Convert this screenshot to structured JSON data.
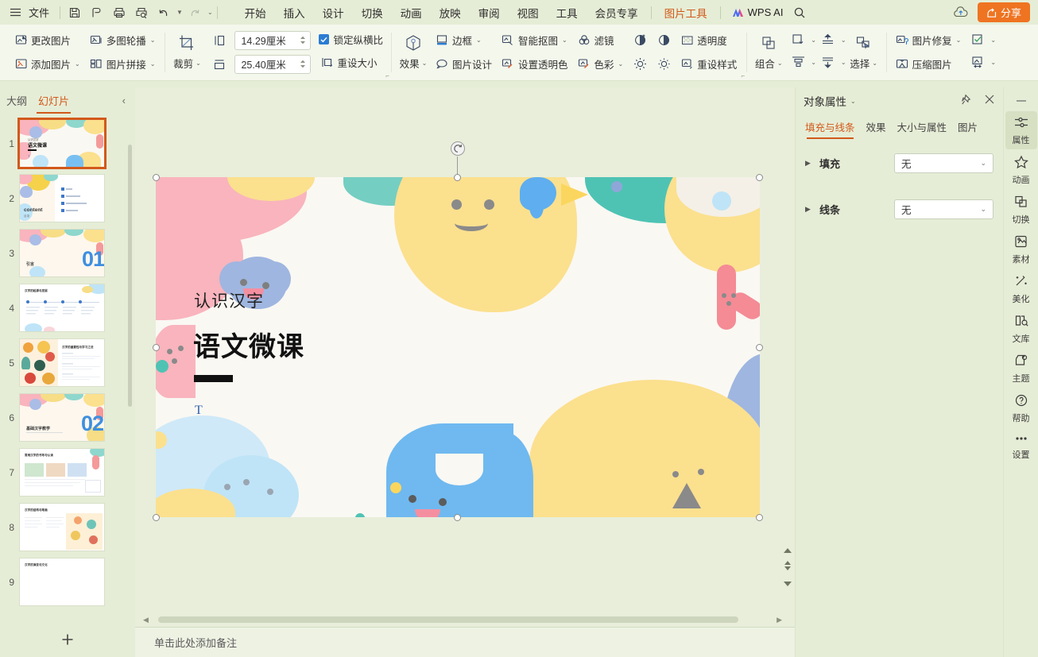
{
  "app": {
    "file_menu": "文件",
    "quick_icons": [
      "save-icon",
      "cloud-save-icon",
      "print-icon",
      "print-preview-icon",
      "undo-icon",
      "redo-icon",
      "customize-icon"
    ],
    "menus": [
      {
        "label": "开始",
        "active": false
      },
      {
        "label": "插入",
        "active": false
      },
      {
        "label": "设计",
        "active": false
      },
      {
        "label": "切换",
        "active": false
      },
      {
        "label": "动画",
        "active": false
      },
      {
        "label": "放映",
        "active": false
      },
      {
        "label": "审阅",
        "active": false
      },
      {
        "label": "视图",
        "active": false
      },
      {
        "label": "工具",
        "active": false
      },
      {
        "label": "会员专享",
        "active": false
      },
      {
        "label": "图片工具",
        "active": true
      }
    ],
    "wps_ai": "WPS AI",
    "search_icon": "search-icon",
    "upload_icon": "cloud-upload-icon",
    "share_label": "分享"
  },
  "ribbon": {
    "group_picture": {
      "change_picture": "更改图片",
      "add_picture": "添加图片",
      "multi_carousel": "多图轮播",
      "picture_stitch": "图片拼接"
    },
    "group_size": {
      "crop": "裁剪",
      "height_value": "14.29厘米",
      "width_value": "25.40厘米",
      "lock_ratio": "锁定纵横比",
      "lock_ratio_checked": true,
      "reset_size": "重设大小"
    },
    "group_style": {
      "effects": "效果",
      "border": "边框",
      "picture_design": "图片设计",
      "smart_cutout": "智能抠图",
      "set_transparent_color": "设置透明色",
      "filter": "滤镜",
      "color": "色彩",
      "transparency": "透明度",
      "reset_style": "重设样式"
    },
    "group_arrange": {
      "group": "组合",
      "rotate": "旋转",
      "align": "对齐",
      "bring_forward": "上移一层",
      "send_backward": "下移一层",
      "select": "选择"
    },
    "group_repair": {
      "picture_repair": "图片修复",
      "compress_picture": "压缩图片"
    }
  },
  "left_panel": {
    "tabs": [
      {
        "label": "大纲",
        "active": false
      },
      {
        "label": "幻灯片",
        "active": true
      }
    ],
    "collapse_icon": "chevron-left-icon",
    "add_slide_icon": "plus-icon",
    "slides": [
      {
        "number": "1",
        "selected": true,
        "kind": "cover",
        "title": "语文微课"
      },
      {
        "number": "2",
        "selected": false,
        "kind": "content",
        "title": "content"
      },
      {
        "number": "3",
        "selected": false,
        "kind": "section",
        "title": "引言",
        "big": "01"
      },
      {
        "number": "4",
        "selected": false,
        "kind": "timeline",
        "title": "汉字的起源与发展"
      },
      {
        "number": "5",
        "selected": false,
        "kind": "imagetext",
        "title": "汉字的重要性与学习之法"
      },
      {
        "number": "6",
        "selected": false,
        "kind": "section",
        "title": "基础汉字教学",
        "big": "02"
      },
      {
        "number": "7",
        "selected": false,
        "kind": "gallery",
        "title": "常用汉字的书写与认读"
      },
      {
        "number": "8",
        "selected": false,
        "kind": "grid",
        "title": "汉字的结构与笔画"
      },
      {
        "number": "9",
        "selected": false,
        "kind": "plain",
        "title": "汉字的演变与文化"
      }
    ]
  },
  "slide": {
    "subtitle": "认识汉字",
    "title": "语文微课",
    "text_placeholder": "T",
    "rotate_handle": "rotate-handle"
  },
  "notes": {
    "placeholder": "单击此处添加备注"
  },
  "right_panel": {
    "title": "对象属性",
    "dropdown_icon": "chevron-down-icon",
    "pin_icon": "pin-icon",
    "close_icon": "close-icon",
    "tabs": [
      {
        "label": "填充与线条",
        "active": true
      },
      {
        "label": "效果",
        "active": false
      },
      {
        "label": "大小与属性",
        "active": false
      },
      {
        "label": "图片",
        "active": false
      }
    ],
    "rows": [
      {
        "label": "填充",
        "value": "无"
      },
      {
        "label": "线条",
        "value": "无"
      }
    ]
  },
  "rail": {
    "minimize_icon": "minimize-icon",
    "items": [
      {
        "label": "属性",
        "icon": "properties-icon",
        "active": true
      },
      {
        "label": "动画",
        "icon": "star-icon",
        "active": false
      },
      {
        "label": "切换",
        "icon": "transition-icon",
        "active": false
      },
      {
        "label": "素材",
        "icon": "material-icon",
        "active": false
      },
      {
        "label": "美化",
        "icon": "beautify-icon",
        "active": false
      },
      {
        "label": "文库",
        "icon": "library-icon",
        "active": false
      },
      {
        "label": "主题",
        "icon": "theme-icon",
        "active": false
      },
      {
        "label": "帮助",
        "icon": "help-icon",
        "active": false
      },
      {
        "label": "设置",
        "icon": "more-dots-icon",
        "active": false
      }
    ]
  },
  "colors": {
    "chrome_bg": "#e6edd6",
    "ribbon_bg": "#f4f7ec",
    "accent": "#d2591b",
    "share_btn": "#ef7421",
    "slide_bg": "#faf8f3",
    "canvas_bg": "#e8eeda"
  }
}
